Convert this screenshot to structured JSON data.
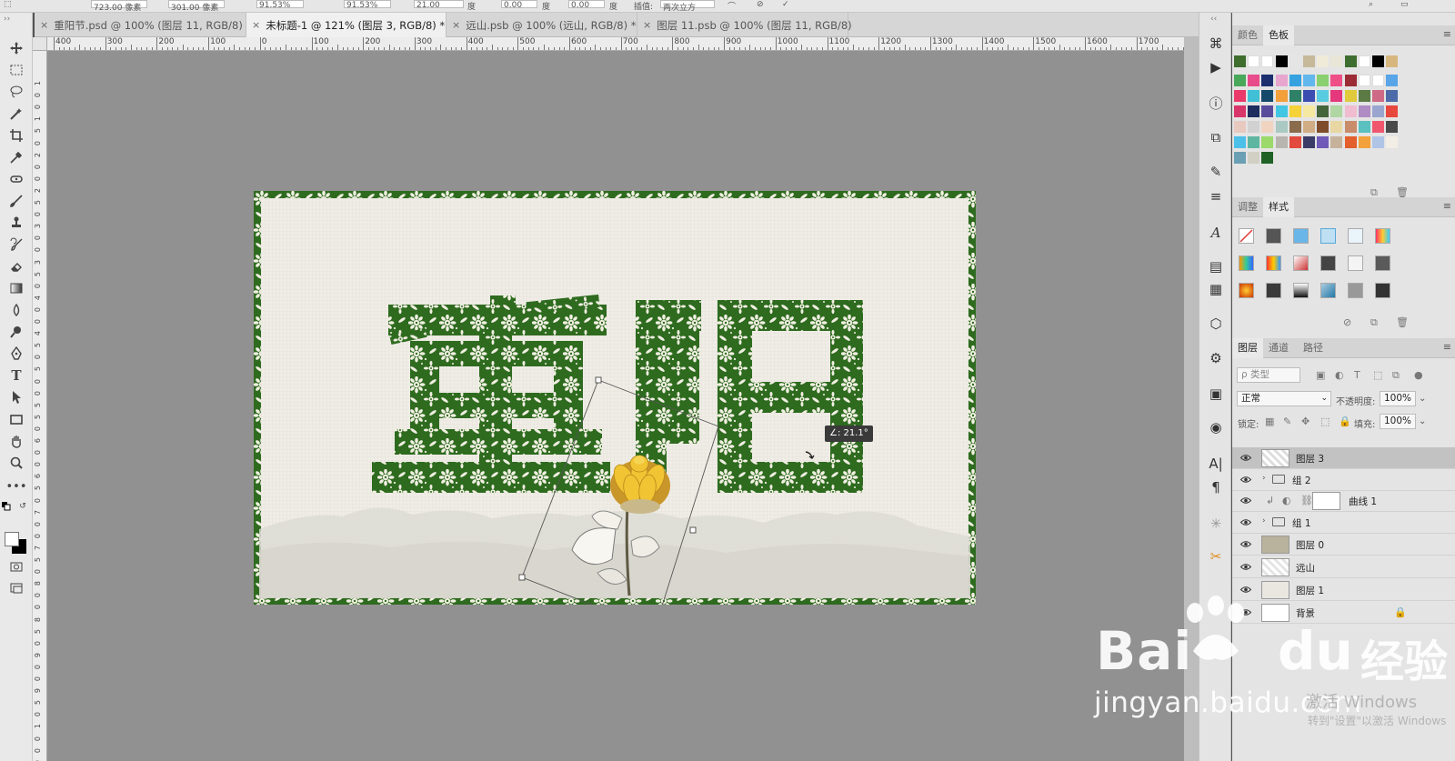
{
  "tabs": [
    {
      "label": "重阳节.psd @ 100% (图层 11, RGB/8) *",
      "active": false
    },
    {
      "label": "未标题-1 @ 121% (图层 3, RGB/8) *",
      "active": true
    },
    {
      "label": "远山.psb @ 100% (远山, RGB/8) *",
      "active": false
    },
    {
      "label": "图层 11.psb @ 100% (图层 11, RGB/8)",
      "active": false
    }
  ],
  "options": {
    "x_field": "723.00 像素",
    "y_field": "301.00 像素",
    "w_field": "91.53%",
    "h_field": "91.53%",
    "angle_field": "21.00",
    "h_skew": "0.00",
    "v_skew": "0.00",
    "interp": "两次立方",
    "deg1": "度",
    "deg2": "度",
    "deg3": "度",
    "interp_label": "插值:"
  },
  "ruler": {
    "top_labels": [
      "400",
      "300",
      "200",
      "100",
      "0",
      "100",
      "200",
      "300",
      "400",
      "500",
      "600",
      "700",
      "800",
      "900",
      "1000",
      "1100",
      "1200",
      "1300",
      "1400",
      "1500",
      "1600",
      "1700"
    ],
    "left_labels": [
      "1",
      "0",
      "0",
      "1",
      "5",
      "0",
      "2",
      "0",
      "0",
      "2",
      "5",
      "0",
      "3",
      "0",
      "0",
      "3",
      "5",
      "0",
      "4",
      "0",
      "0",
      "4",
      "5",
      "0",
      "5",
      "0",
      "0",
      "5",
      "5",
      "0",
      "6",
      "0",
      "0",
      "6",
      "5",
      "0",
      "7",
      "0",
      "0",
      "7",
      "5",
      "0",
      "8",
      "0",
      "0",
      "8",
      "5",
      "0",
      "9",
      "0",
      "0",
      "9",
      "5",
      "0",
      "1",
      "0",
      "0",
      "0"
    ]
  },
  "canvas": {
    "title_chars": [
      "重",
      "阳"
    ],
    "rotation_tooltip": "∠: 21.1°",
    "colors": {
      "paper": "#efede6",
      "floral_green": "#2e6b1f",
      "flower_yellow": "#e8b628",
      "pasteboard": "#919191"
    }
  },
  "panels": {
    "color_tab": "颜色",
    "swatches_tab": "色板",
    "adjust_tab": "调整",
    "styles_tab": "样式",
    "layers_tab": "图层",
    "channels_tab": "通道",
    "paths_tab": "路径",
    "filter_placeholder": "ρ 类型",
    "blend_mode": "正常",
    "opacity_label": "不透明度:",
    "opacity_value": "100%",
    "lock_label": "锁定:",
    "fill_label": "填充:",
    "fill_value": "100%",
    "layers": [
      {
        "name": "图层 3",
        "type": "pixel",
        "selected": true
      },
      {
        "name": "组 2",
        "type": "group",
        "selected": false
      },
      {
        "name": "曲线 1",
        "type": "adjustment",
        "selected": false
      },
      {
        "name": "组 1",
        "type": "group",
        "selected": false
      },
      {
        "name": "图层 0",
        "type": "smart",
        "selected": false
      },
      {
        "name": "远山",
        "type": "pixel",
        "selected": false
      },
      {
        "name": "图层 1",
        "type": "pixel",
        "selected": false
      },
      {
        "name": "背景",
        "type": "background",
        "selected": false
      }
    ]
  },
  "swatches": {
    "row0": [
      "#3f6e2e",
      "#ffffff",
      "#ffffff",
      "#000000",
      "#e5e5e5",
      "#c5b99a",
      "#f0ead9",
      "#e9e5d7",
      "#3e6e2f",
      "#ffffff",
      "#000000",
      "#d8b77f"
    ],
    "row1": [
      "#4aa85a",
      "#e84c8a",
      "#1d2e6f",
      "#e8a6cf",
      "#36a2e0",
      "#62b8ec",
      "#8bd070",
      "#ee4f87",
      "#9b2c36",
      "#ffffff",
      "#ffffff",
      "#59a5e8"
    ],
    "row2": [
      "#e93a6b",
      "#3fc0d6",
      "#15496b",
      "#f39f3a",
      "#2e8066",
      "#3b4db0",
      "#59cbe0",
      "#e5377b",
      "#e0c93b",
      "#5b7a44",
      "#cf6a86",
      "#4c6ba8"
    ],
    "row3": [
      "#d8356a",
      "#1c2d5e",
      "#5a4c9c",
      "#43c6e3",
      "#f5d238",
      "#f5e9a2",
      "#44653a",
      "#b0d6a3",
      "#f0bcd0",
      "#b08cc4",
      "#9aa6cf",
      "#e8473e"
    ],
    "row4": [
      "#e8c9c0",
      "#d1d1d1",
      "#f0d3c1",
      "#a9c9c2",
      "#8a6b4c",
      "#d0ad84",
      "#7e4c2a",
      "#e8d7a3",
      "#c98c6a",
      "#5ac0c0",
      "#f0576f",
      "#4a4a4a"
    ],
    "row5": [
      "#4cc0e8",
      "#5fb6a0",
      "#9bd96b",
      "#b8b5b0",
      "#e14a3c",
      "#3a3b66",
      "#6f5ab8",
      "#c6b29b",
      "#e35f2c",
      "#f3a13a",
      "#b0c4e6",
      "#f3eee5"
    ],
    "row6": [
      "#6a9fb4",
      "#d2d0c4",
      "#1f6226",
      "#00000000",
      "#00000000",
      "#00000000",
      "#00000000",
      "#00000000",
      "#00000000",
      "#00000000",
      "#00000000",
      "#00000000"
    ]
  },
  "watermark": {
    "logo_text_1": "Bai",
    "logo_text_2": "du",
    "logo_cn": "经验",
    "url": "jingyan.baidu.com",
    "activate_1": "激活 Windows",
    "activate_2": "转到\"设置\"以激活 Windows"
  }
}
